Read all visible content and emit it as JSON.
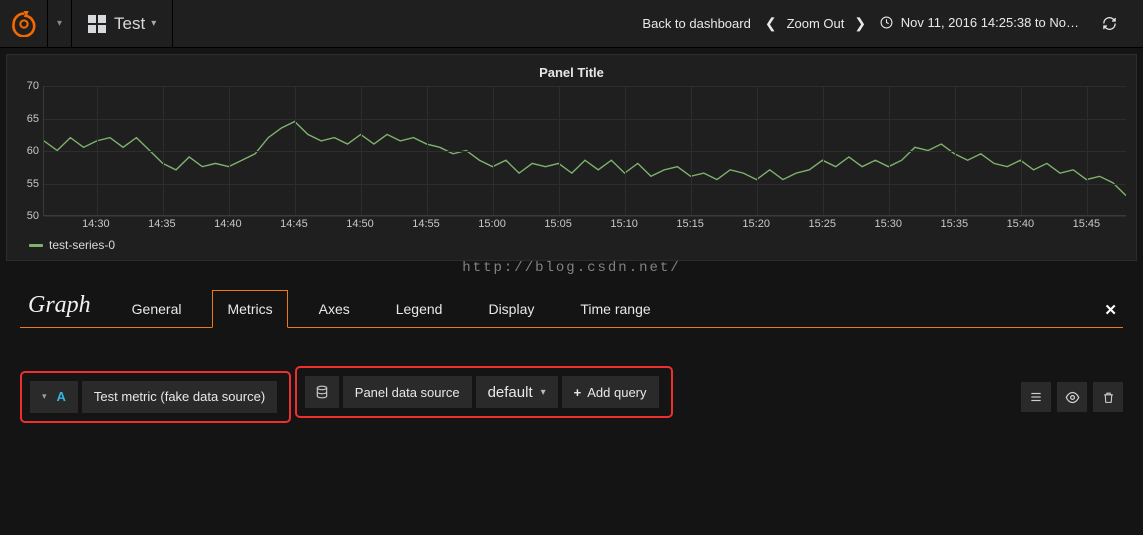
{
  "navbar": {
    "dashboard_name": "Test",
    "back_label": "Back to dashboard",
    "zoom_label": "Zoom Out",
    "time_range_label": "Nov 11, 2016 14:25:38 to No…"
  },
  "panel": {
    "title": "Panel Title",
    "legend_series": "test-series-0",
    "series_color": "#7eb26d",
    "watermark": "http://blog.csdn.net/"
  },
  "editor": {
    "title": "Graph",
    "tabs": [
      "General",
      "Metrics",
      "Axes",
      "Legend",
      "Display",
      "Time range"
    ],
    "active_tab": 1,
    "query_letter": "A",
    "query_summary": "Test metric (fake data source)",
    "datasource_label": "Panel data source",
    "datasource_value": "default",
    "add_query_label": "Add query"
  },
  "chart_data": {
    "type": "line",
    "title": "Panel Title",
    "xlabel": "",
    "ylabel": "",
    "ylim": [
      50,
      70
    ],
    "x_ticks": [
      "14:30",
      "14:35",
      "14:40",
      "14:45",
      "14:50",
      "14:55",
      "15:00",
      "15:05",
      "15:10",
      "15:15",
      "15:20",
      "15:25",
      "15:30",
      "15:35",
      "15:40",
      "15:45"
    ],
    "y_ticks": [
      50,
      55,
      60,
      65,
      70
    ],
    "series": [
      {
        "name": "test-series-0",
        "color": "#7eb26d",
        "x": [
          "14:26",
          "14:27",
          "14:28",
          "14:29",
          "14:30",
          "14:31",
          "14:32",
          "14:33",
          "14:34",
          "14:35",
          "14:36",
          "14:37",
          "14:38",
          "14:39",
          "14:40",
          "14:41",
          "14:42",
          "14:43",
          "14:44",
          "14:45",
          "14:46",
          "14:47",
          "14:48",
          "14:49",
          "14:50",
          "14:51",
          "14:52",
          "14:53",
          "14:54",
          "14:55",
          "14:56",
          "14:57",
          "14:58",
          "14:59",
          "15:00",
          "15:01",
          "15:02",
          "15:03",
          "15:04",
          "15:05",
          "15:06",
          "15:07",
          "15:08",
          "15:09",
          "15:10",
          "15:11",
          "15:12",
          "15:13",
          "15:14",
          "15:15",
          "15:16",
          "15:17",
          "15:18",
          "15:19",
          "15:20",
          "15:21",
          "15:22",
          "15:23",
          "15:24",
          "15:25",
          "15:26",
          "15:27",
          "15:28",
          "15:29",
          "15:30",
          "15:31",
          "15:32",
          "15:33",
          "15:34",
          "15:35",
          "15:36",
          "15:37",
          "15:38",
          "15:39",
          "15:40",
          "15:41",
          "15:42",
          "15:43",
          "15:44",
          "15:45",
          "15:46",
          "15:47",
          "15:48"
        ],
        "values": [
          61.5,
          60.0,
          62.0,
          60.5,
          61.5,
          62.0,
          60.5,
          62.0,
          60.0,
          58.0,
          57.0,
          59.0,
          57.5,
          58.0,
          57.5,
          58.5,
          59.5,
          62.0,
          63.5,
          64.5,
          62.5,
          61.5,
          62.0,
          61.0,
          62.5,
          61.0,
          62.5,
          61.5,
          62.0,
          61.0,
          60.5,
          59.5,
          60.0,
          58.5,
          57.5,
          58.5,
          56.5,
          58.0,
          57.5,
          58.0,
          56.5,
          58.5,
          57.0,
          58.5,
          56.5,
          58.0,
          56.0,
          57.0,
          57.5,
          56.0,
          56.5,
          55.5,
          57.0,
          56.5,
          55.5,
          57.0,
          55.5,
          56.5,
          57.0,
          58.5,
          57.5,
          59.0,
          57.5,
          58.5,
          57.5,
          58.5,
          60.5,
          60.0,
          61.0,
          59.5,
          58.5,
          59.5,
          58.0,
          57.5,
          58.5,
          57.0,
          58.0,
          56.5,
          57.0,
          55.5,
          56.0,
          55.0,
          53.0
        ]
      }
    ]
  }
}
